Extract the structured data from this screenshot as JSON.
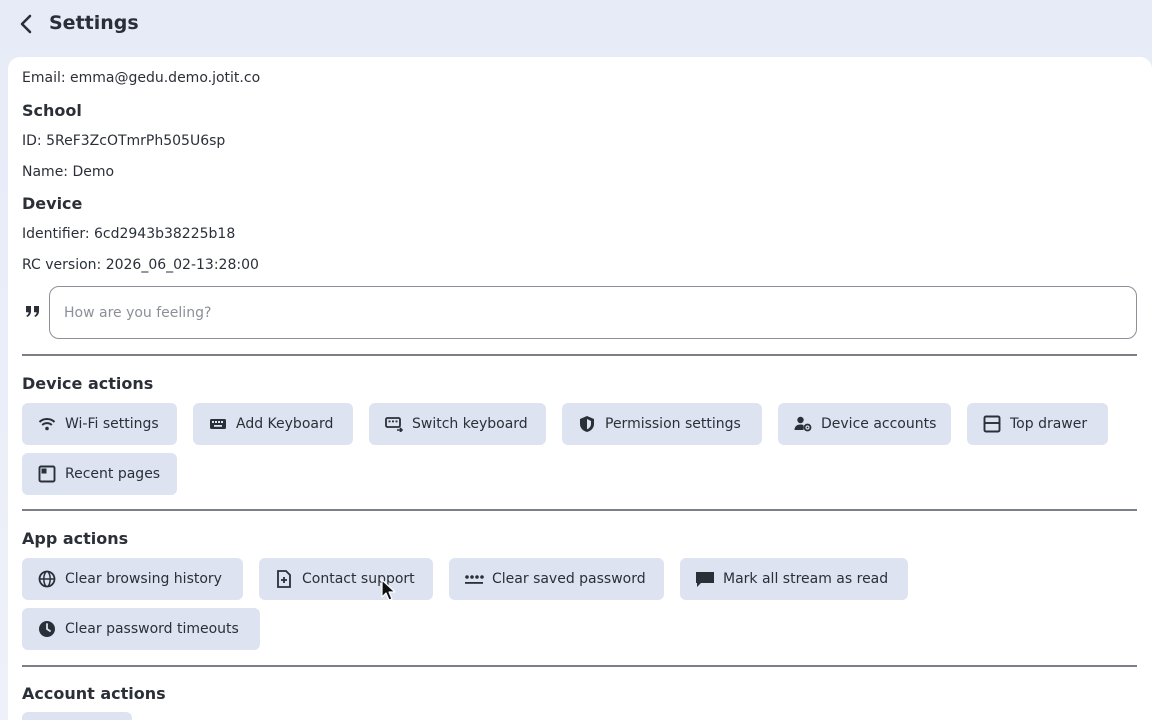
{
  "header": {
    "title": "Settings"
  },
  "info": {
    "email": "Email: emma@gedu.demo.jotit.co",
    "school_heading": "School",
    "school_id": "ID: 5ReF3ZcOTmrPh505U6sp",
    "school_name": "Name: Demo",
    "device_heading": "Device",
    "device_identifier": "Identifier: 6cd2943b38225b18",
    "rc_version": "RC version: 2026_06_02-13:28:00"
  },
  "status": {
    "placeholder": "How are you feeling?",
    "value": ""
  },
  "device_actions": {
    "heading": "Device actions",
    "items": [
      {
        "label": "Wi-Fi settings",
        "icon": "wifi-icon"
      },
      {
        "label": "Add Keyboard",
        "icon": "keyboard-icon"
      },
      {
        "label": "Switch keyboard",
        "icon": "keyboard-switch-icon"
      },
      {
        "label": "Permission settings",
        "icon": "shield-icon"
      },
      {
        "label": "Device accounts",
        "icon": "person-gear-icon"
      },
      {
        "label": "Top drawer",
        "icon": "drawer-icon"
      },
      {
        "label": "Recent pages",
        "icon": "recent-pages-icon"
      }
    ]
  },
  "app_actions": {
    "heading": "App actions",
    "items": [
      {
        "label": "Clear browsing history",
        "icon": "globe-icon"
      },
      {
        "label": "Contact support",
        "icon": "document-icon"
      },
      {
        "label": "Clear saved password",
        "icon": "password-icon"
      },
      {
        "label": "Mark all stream as read",
        "icon": "message-icon"
      },
      {
        "label": "Clear password timeouts",
        "icon": "clock-icon"
      }
    ]
  },
  "account_actions": {
    "heading": "Account actions"
  },
  "colors": {
    "chip_bg": "#dde3f0",
    "background": "#e6ebf7",
    "text": "#2b2f38"
  }
}
